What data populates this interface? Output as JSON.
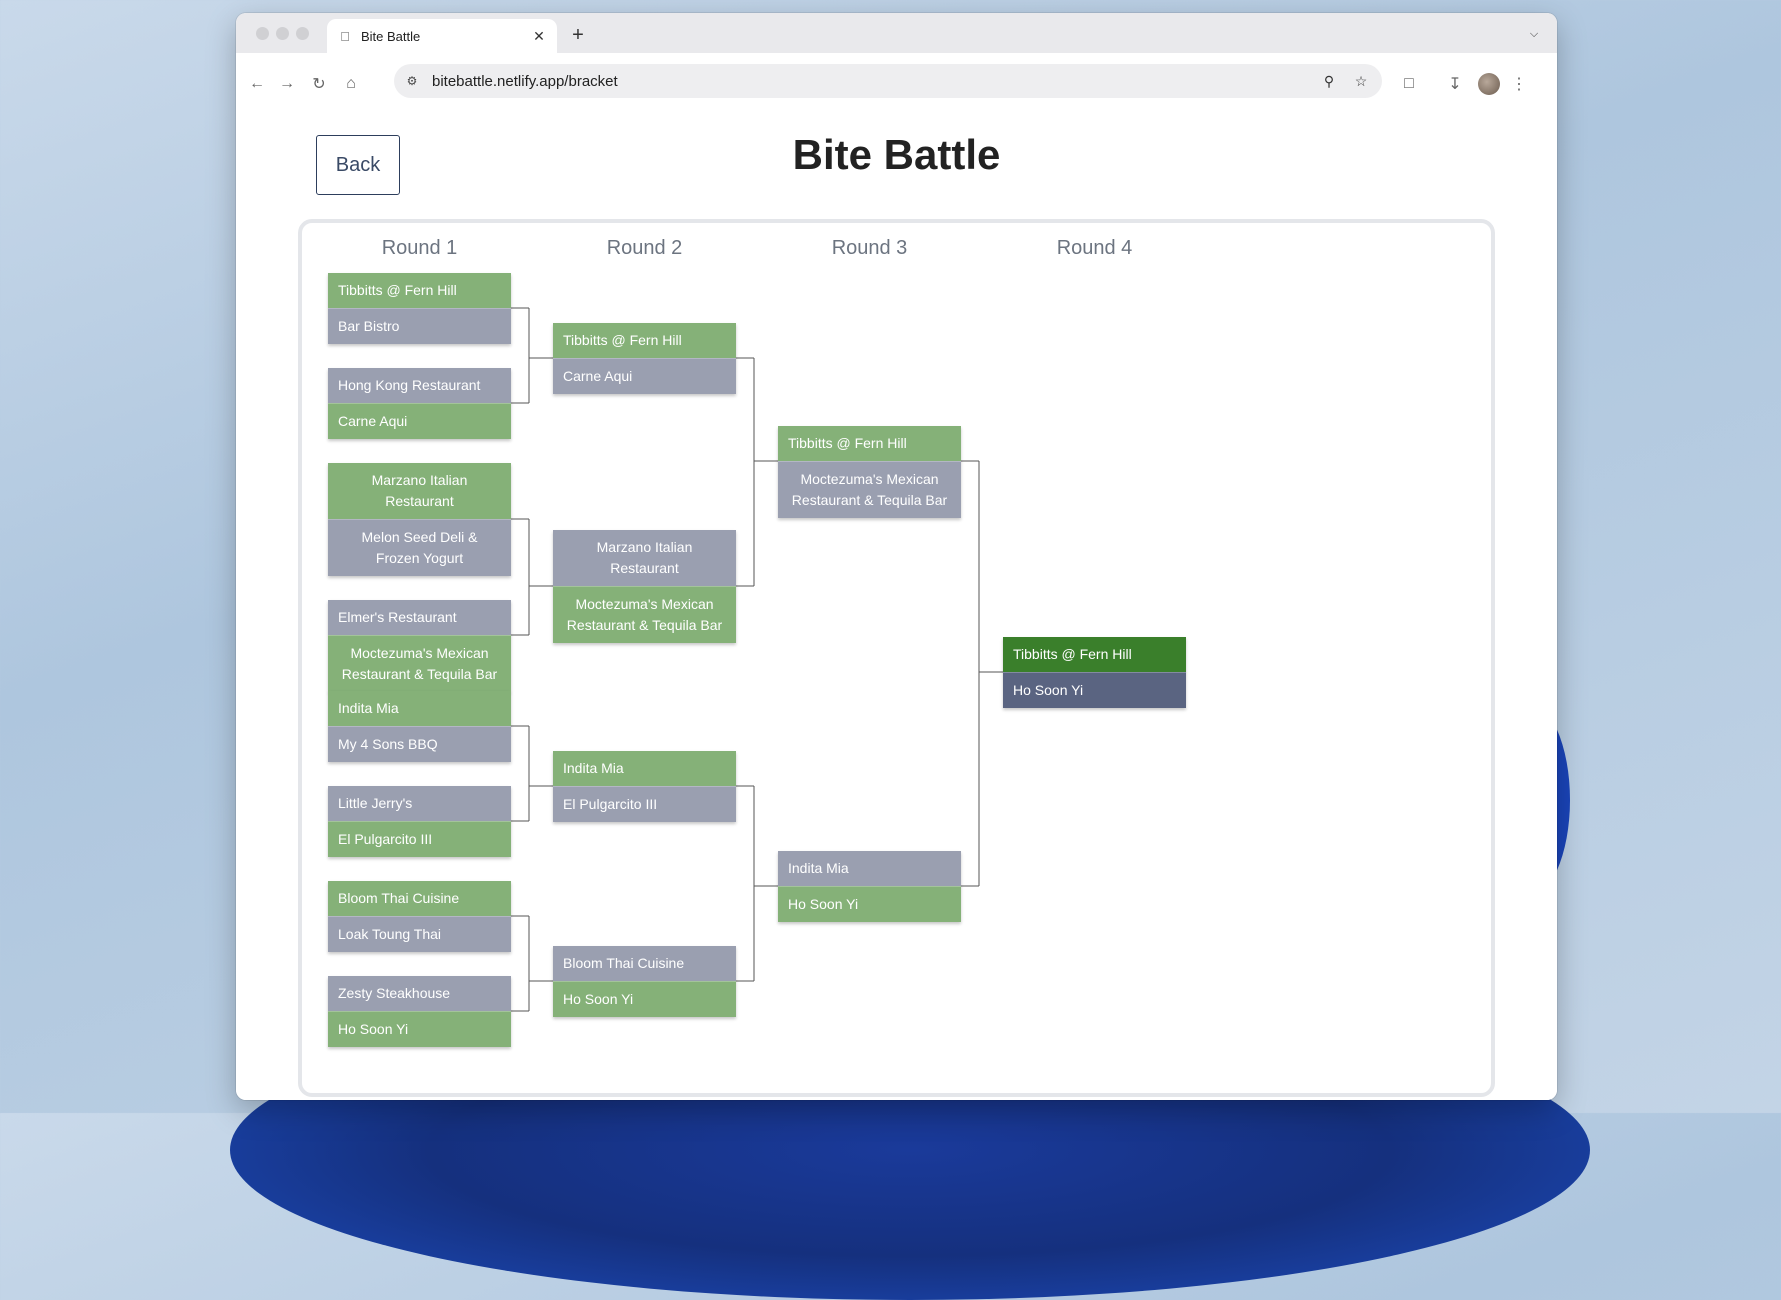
{
  "browser": {
    "tab_title": "Bite Battle",
    "url": "bitebattle.netlify.app/bracket"
  },
  "page": {
    "back_label": "Back",
    "title": "Bite Battle"
  },
  "rounds": [
    "Round 1",
    "Round 2",
    "Round 3",
    "Round 4"
  ],
  "colors": {
    "winner": "#85b178",
    "loser": "#9a9fb0",
    "champion": "#3a7f2b",
    "runner_up": "#5a6481"
  },
  "round1": [
    {
      "top": {
        "name": "Tibbitts @ Fern Hill",
        "result": "win"
      },
      "bottom": {
        "name": "Bar Bistro",
        "result": "lose"
      }
    },
    {
      "top": {
        "name": "Hong Kong Restaurant",
        "result": "lose"
      },
      "bottom": {
        "name": "Carne Aqui",
        "result": "win"
      }
    },
    {
      "top": {
        "name": "Marzano Italian Restaurant",
        "result": "win"
      },
      "bottom": {
        "name": "Melon Seed Deli & Frozen Yogurt",
        "result": "lose"
      }
    },
    {
      "top": {
        "name": "Elmer's Restaurant",
        "result": "lose"
      },
      "bottom": {
        "name": "Moctezuma's Mexican Restaurant & Tequila Bar",
        "result": "win"
      }
    },
    {
      "top": {
        "name": "Indita Mia",
        "result": "win"
      },
      "bottom": {
        "name": "My 4 Sons BBQ",
        "result": "lose"
      }
    },
    {
      "top": {
        "name": "Little Jerry's",
        "result": "lose"
      },
      "bottom": {
        "name": "El Pulgarcito III",
        "result": "win"
      }
    },
    {
      "top": {
        "name": "Bloom Thai Cuisine",
        "result": "win"
      },
      "bottom": {
        "name": "Loak Toung Thai",
        "result": "lose"
      }
    },
    {
      "top": {
        "name": "Zesty Steakhouse",
        "result": "lose"
      },
      "bottom": {
        "name": "Ho Soon Yi",
        "result": "win"
      }
    }
  ],
  "round2": [
    {
      "top": {
        "name": "Tibbitts @ Fern Hill",
        "result": "win"
      },
      "bottom": {
        "name": "Carne Aqui",
        "result": "lose"
      }
    },
    {
      "top": {
        "name": "Marzano Italian Restaurant",
        "result": "lose"
      },
      "bottom": {
        "name": "Moctezuma's Mexican Restaurant & Tequila Bar",
        "result": "win"
      }
    },
    {
      "top": {
        "name": "Indita Mia",
        "result": "win"
      },
      "bottom": {
        "name": "El Pulgarcito III",
        "result": "lose"
      }
    },
    {
      "top": {
        "name": "Bloom Thai Cuisine",
        "result": "lose"
      },
      "bottom": {
        "name": "Ho Soon Yi",
        "result": "win"
      }
    }
  ],
  "round3": [
    {
      "top": {
        "name": "Tibbitts @ Fern Hill",
        "result": "win"
      },
      "bottom": {
        "name": "Moctezuma's Mexican Restaurant & Tequila Bar",
        "result": "lose"
      }
    },
    {
      "top": {
        "name": "Indita Mia",
        "result": "lose"
      },
      "bottom": {
        "name": "Ho Soon Yi",
        "result": "win"
      }
    }
  ],
  "round4": [
    {
      "top": {
        "name": "Tibbitts @ Fern Hill",
        "result": "champion"
      },
      "bottom": {
        "name": "Ho Soon Yi",
        "result": "runner-up"
      }
    }
  ]
}
